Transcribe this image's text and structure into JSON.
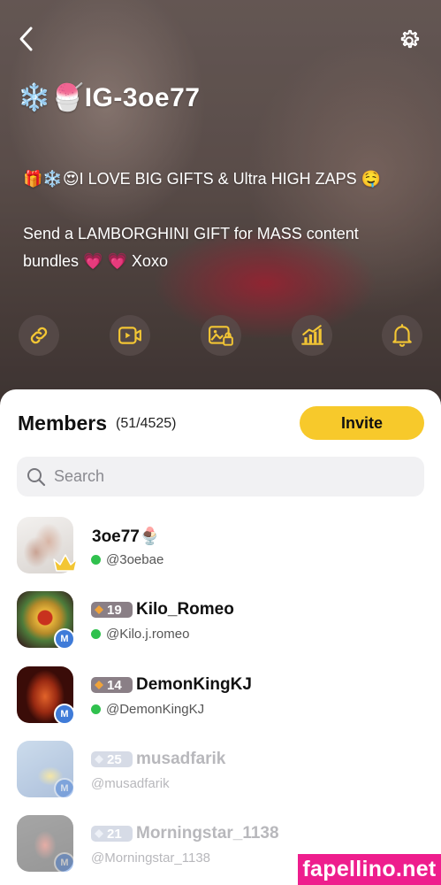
{
  "header": {
    "title": "IG-3oe77",
    "title_emoji": "❄️🍧",
    "description_line1_emoji": "🎁❄️😍",
    "description_line1": "I LOVE BIG GIFTS & Ultra HIGH ZAPS",
    "description_line1_end_emoji": "🤤",
    "description_line2": "Send a LAMBORGHINI GIFT for MASS content",
    "description_line3_start": "bundles",
    "description_line3_emoji": "💗 💗",
    "description_line3_end": "Xoxo"
  },
  "actions": [
    {
      "icon": "link-icon"
    },
    {
      "icon": "video-icon"
    },
    {
      "icon": "locked-image-icon"
    },
    {
      "icon": "stats-icon"
    },
    {
      "icon": "bell-icon"
    }
  ],
  "members": {
    "title": "Members",
    "count": "(51/4525)",
    "invite_label": "Invite",
    "search_placeholder": "Search",
    "list": [
      {
        "name": "3oe77",
        "name_emoji": "🍨",
        "handle": "@3oebae",
        "role": "crown",
        "level": null,
        "online": true,
        "faded": false
      },
      {
        "name": "Kilo_Romeo",
        "handle": "@Kilo.j.romeo",
        "role": "M",
        "level": "19",
        "online": true,
        "faded": false
      },
      {
        "name": "DemonKingKJ",
        "handle": "@DemonKingKJ",
        "role": "M",
        "level": "14",
        "online": true,
        "faded": false
      },
      {
        "name": "musadfarik",
        "handle": "@musadfarik",
        "role": "M",
        "level": "25",
        "online": false,
        "faded": true
      },
      {
        "name": "Morningstar_1138",
        "handle": "@Morningstar_1138",
        "role": "M",
        "level": "21",
        "online": false,
        "faded": true
      }
    ]
  },
  "watermark": "fapellino.net",
  "colors": {
    "accent": "#f7c92b",
    "icon_yellow": "#f3c634",
    "online": "#30c14e",
    "role_m": "#3f7bd8",
    "watermark": "#ee1e8d"
  }
}
